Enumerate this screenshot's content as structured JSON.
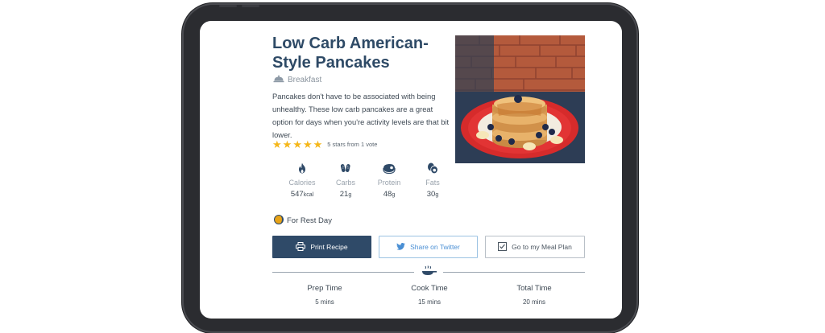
{
  "recipe": {
    "title": "Low Carb American-Style Pancakes",
    "category": "Breakfast",
    "description": "Pancakes don't have to be associated with being unhealthy. These low carb pancakes are a great option for days when you're activity levels are that bit lower.",
    "rating": {
      "stars": 5,
      "max_stars": 5,
      "text": "5 stars from 1 vote"
    },
    "image_icon": "pancake-stack-photo"
  },
  "nutrition": [
    {
      "name": "Calories",
      "value": "547",
      "unit": "kcal",
      "icon": "flame-icon"
    },
    {
      "name": "Carbs",
      "value": "21",
      "unit": "g",
      "icon": "carbs-icon"
    },
    {
      "name": "Protein",
      "value": "48",
      "unit": "g",
      "icon": "protein-icon"
    },
    {
      "name": "Fats",
      "value": "30",
      "unit": "g",
      "icon": "fats-icon"
    }
  ],
  "day_type": "For Rest Day",
  "actions": {
    "print": "Print Recipe",
    "twitter": "Share on Twitter",
    "meal_plan": "Go to my Meal Plan"
  },
  "times": [
    {
      "label": "Prep Time",
      "value": "5",
      "unit": "mins"
    },
    {
      "label": "Cook Time",
      "value": "15",
      "unit": "mins"
    },
    {
      "label": "Total Time",
      "value": "20",
      "unit": "mins"
    }
  ],
  "colors": {
    "title": "#2e4a66",
    "primary_button": "#2f4a68",
    "twitter": "#4a8fd4",
    "star": "#f5b71a",
    "device_frame": "#2b2c30"
  }
}
